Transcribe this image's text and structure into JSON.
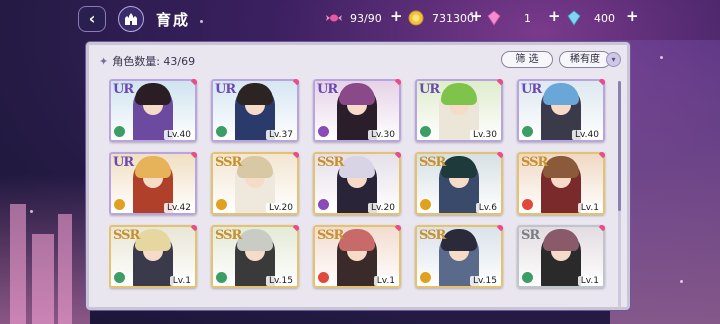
{
  "header": {
    "title": "育成",
    "back_icon": "back-chevron-icon",
    "home_icon": "castle-home-icon"
  },
  "resources": [
    {
      "name": "candy",
      "icon": "candy-icon",
      "value": "93/90",
      "color": "#e85aa0"
    },
    {
      "name": "coin",
      "icon": "coin-icon",
      "value": "731300",
      "color": "#f0c33c"
    },
    {
      "name": "pink_gem",
      "icon": "pink-gem-icon",
      "value": "1",
      "color": "#f38cd0"
    },
    {
      "name": "blue_gem",
      "icon": "blue-gem-icon",
      "value": "400",
      "color": "#7fd6f2"
    }
  ],
  "panel": {
    "count_label": "角色数量: 43/69",
    "filter_button": "筛 选",
    "sort_button": "稀有度",
    "sort_toggle_icon": "chevron-down-icon"
  },
  "cards": [
    {
      "rarity": "UR",
      "level": "Lv.40",
      "attr_color": "#3c9e64",
      "hair": "#2a1e24",
      "outfit": "#6b4aa0",
      "bg": "#cfe3ef"
    },
    {
      "rarity": "UR",
      "level": "Lv.37",
      "attr_color": "#3c9e64",
      "hair": "#2b2422",
      "outfit": "#2a3a6a",
      "bg": "#d6e6f2"
    },
    {
      "rarity": "UR",
      "level": "Lv.30",
      "attr_color": "#8a4ab8",
      "hair": "#8a4a8a",
      "outfit": "#2a1e2a",
      "bg": "#e6d2e6"
    },
    {
      "rarity": "UR",
      "level": "Lv.30",
      "attr_color": "#3c9e64",
      "hair": "#7ec44a",
      "outfit": "#ece6d8",
      "bg": "#dfeccd"
    },
    {
      "rarity": "UR",
      "level": "Lv.40",
      "attr_color": "#3c9e64",
      "hair": "#6aa6d8",
      "outfit": "#3a3a4a",
      "bg": "#dde8f0"
    },
    {
      "rarity": "UR",
      "level": "Lv.42",
      "attr_color": "#e0a020",
      "hair": "#e6b25a",
      "outfit": "#b0402a",
      "bg": "#f0dfc2"
    },
    {
      "rarity": "SSR",
      "level": "Lv.20",
      "attr_color": "#e0a020",
      "hair": "#d8c8a4",
      "outfit": "#efe8dc",
      "bg": "#f3e6d3"
    },
    {
      "rarity": "SSR",
      "level": "Lv.20",
      "attr_color": "#8a4ab8",
      "hair": "#d8d4e6",
      "outfit": "#2a2438",
      "bg": "#e6e0ea"
    },
    {
      "rarity": "SSR",
      "level": "Lv.6",
      "attr_color": "#e0a020",
      "hair": "#1e3a3a",
      "outfit": "#3a4a6a",
      "bg": "#d6e0e4"
    },
    {
      "rarity": "SSR",
      "level": "Lv.1",
      "attr_color": "#e04a3a",
      "hair": "#8a5a3a",
      "outfit": "#7a2a2a",
      "bg": "#f0d8c4"
    },
    {
      "rarity": "SSR",
      "level": "Lv.1",
      "attr_color": "#3c9e64",
      "hair": "#e6d6a0",
      "outfit": "#3a3a4a",
      "bg": "#e8e6d6"
    },
    {
      "rarity": "SSR",
      "level": "Lv.15",
      "attr_color": "#3c9e64",
      "hair": "#c8ccc4",
      "outfit": "#3a3a3a",
      "bg": "#e4ead8"
    },
    {
      "rarity": "SSR",
      "level": "Lv.1",
      "attr_color": "#e04a3a",
      "hair": "#c86a6a",
      "outfit": "#3a2a2a",
      "bg": "#f2dcd0"
    },
    {
      "rarity": "SSR",
      "level": "Lv.15",
      "attr_color": "#e0a020",
      "hair": "#2a2a3a",
      "outfit": "#5a6a8a",
      "bg": "#dae2ea"
    },
    {
      "rarity": "SR",
      "level": "Lv.1",
      "attr_color": "#3c9e64",
      "hair": "#8a5a6a",
      "outfit": "#2a2a2a",
      "bg": "#e2dce0"
    }
  ]
}
